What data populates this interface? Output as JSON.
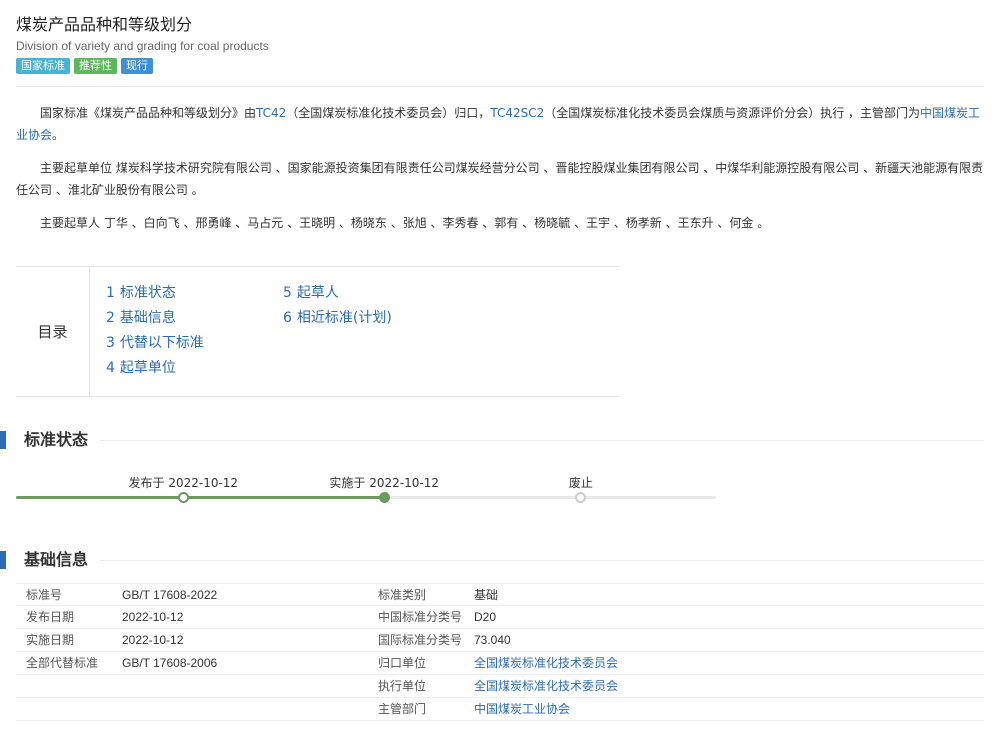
{
  "header": {
    "title": "煤炭产品品种和等级划分",
    "subtitle": "Division of variety and grading for coal products",
    "badges": [
      {
        "label": "国家标准",
        "color": "#46b3d6"
      },
      {
        "label": "推荐性",
        "color": "#5cb85c"
      },
      {
        "label": "现行",
        "color": "#3f8fd6"
      }
    ]
  },
  "intro": {
    "p1": {
      "t1": "国家标准《煤炭产品品种和等级划分》由",
      "l1": "TC42",
      "t2": "（全国煤炭标准化技术委员会）归口，",
      "l2": "TC42SC2",
      "t3": "（全国煤炭标准化技术委员会煤质与资源评价分会）执行 ，主管部门为",
      "l3": "中国煤炭工业协会",
      "t4": "。"
    },
    "p2": "主要起草单位 煤炭科学技术研究院有限公司 、国家能源投资集团有限责任公司煤炭经营分公司 、晋能控股煤业集团有限公司 、中煤华利能源控股有限公司 、新疆天池能源有限责任公司 、淮北矿业股份有限公司 。",
    "p3": "主要起草人 丁华 、白向飞 、邢勇峰 、马占元 、王晓明 、杨晓东 、张旭 、李秀春 、郭有 、杨晓毓 、王宇 、杨孝新 、王东升 、何金 。"
  },
  "toc": {
    "label": "目录",
    "col1": [
      {
        "num": "1",
        "text": "标准状态"
      },
      {
        "num": "2",
        "text": "基础信息"
      },
      {
        "num": "3",
        "text": "代替以下标准"
      },
      {
        "num": "4",
        "text": "起草单位"
      }
    ],
    "col2": [
      {
        "num": "5",
        "text": "起草人"
      },
      {
        "num": "6",
        "text": "相近标准(计划)"
      }
    ]
  },
  "status": {
    "heading": "标准状态",
    "progress": 0.526,
    "steps": [
      {
        "label": "发布于 2022-10-12",
        "pos": 0.239,
        "state": "done"
      },
      {
        "label": "实施于 2022-10-12",
        "pos": 0.526,
        "state": "current"
      },
      {
        "label": "废止",
        "pos": 0.807,
        "state": "pending"
      }
    ],
    "colors": {
      "done": "#6d9a5d",
      "pending": "#cccccc"
    }
  },
  "basic": {
    "heading": "基础信息",
    "rows": [
      {
        "l1": "标准号",
        "v1": "GB/T 17608-2022",
        "l2": "标准类别",
        "v2": "基础",
        "v2link": false
      },
      {
        "l1": "发布日期",
        "v1": "2022-10-12",
        "l2": "中国标准分类号",
        "v2": "D20",
        "v2link": false
      },
      {
        "l1": "实施日期",
        "v1": "2022-10-12",
        "l2": "国际标准分类号",
        "v2": "73.040",
        "v2link": false
      },
      {
        "l1": "全部代替标准",
        "v1": "GB/T 17608-2006",
        "l2": "归口单位",
        "v2": "全国煤炭标准化技术委员会",
        "v2link": true
      },
      {
        "l1": "",
        "v1": "",
        "l2": "执行单位",
        "v2": "全国煤炭标准化技术委员会",
        "v2link": true
      },
      {
        "l1": "",
        "v1": "",
        "l2": "主管部门",
        "v2": "中国煤炭工业协会",
        "v2link": true
      }
    ]
  }
}
